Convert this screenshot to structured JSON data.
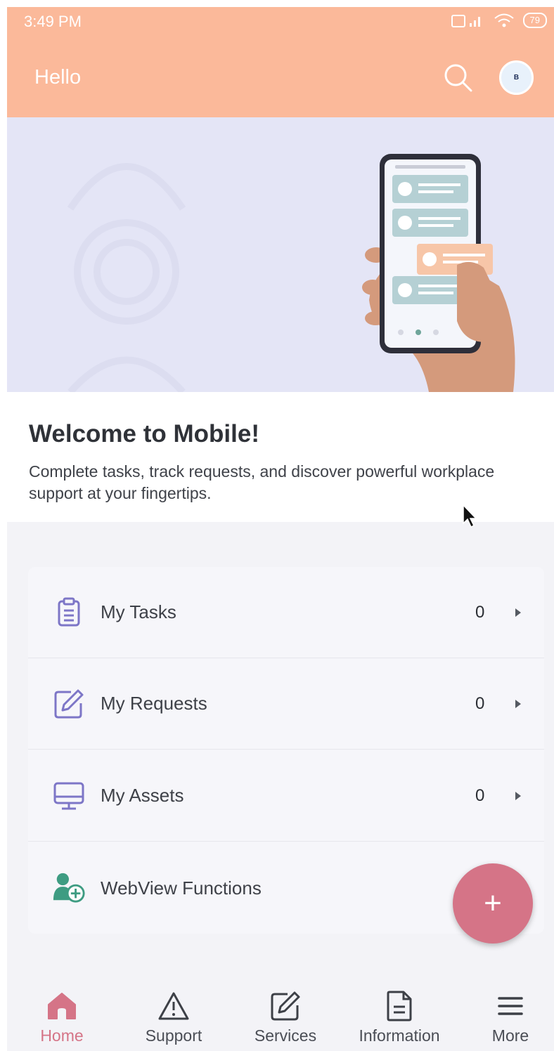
{
  "status_bar": {
    "time": "3:49 PM",
    "battery": "79"
  },
  "app_bar": {
    "greeting": "Hello",
    "avatar_initial": "B"
  },
  "welcome": {
    "title": "Welcome to Mobile!",
    "body": "Complete tasks, track requests, and discover powerful workplace support at your fingertips."
  },
  "menu": {
    "items": [
      {
        "label": "My Tasks",
        "count": "0",
        "icon": "clipboard-icon"
      },
      {
        "label": "My Requests",
        "count": "0",
        "icon": "edit-icon"
      },
      {
        "label": "My Assets",
        "count": "0",
        "icon": "monitor-icon"
      },
      {
        "label": "WebView Functions",
        "icon": "user-add-icon"
      }
    ]
  },
  "fab": {
    "label": "+"
  },
  "bottom_nav": {
    "items": [
      {
        "label": "Home",
        "icon": "home-icon",
        "active": true
      },
      {
        "label": "Support",
        "icon": "warning-icon"
      },
      {
        "label": "Services",
        "icon": "edit-icon"
      },
      {
        "label": "Information",
        "icon": "document-icon"
      },
      {
        "label": "More",
        "icon": "menu-icon"
      }
    ]
  },
  "colors": {
    "header": "#fbb99a",
    "accent": "#d57487",
    "menu_icon": "#7d76c7",
    "webview_icon": "#3e9c82"
  }
}
